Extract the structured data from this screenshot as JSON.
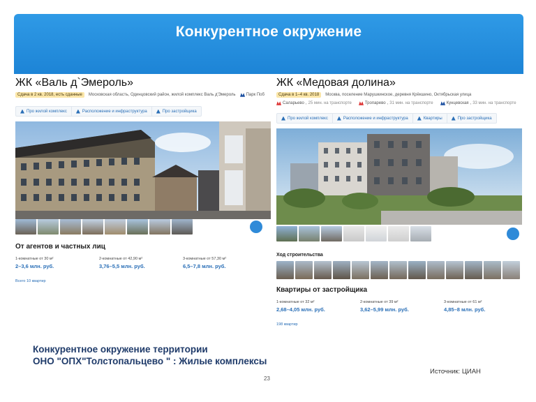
{
  "slide": {
    "title": "Конкурентное окружение",
    "footer_line1": "Конкурентное окружение территории",
    "footer_line2": "ОНО \"ОПХ\"Толстопальцево \" : Жилые комплексы",
    "page_number": "23",
    "source": "Источник: ЦИАН"
  },
  "left": {
    "title": "ЖК «Валь д`Эмероль»",
    "badge": "Сдача в 2 кв. 2018, есть сданные",
    "address": "Московская область, Одинцовский район, жилой комплекс Валь д'Эмероль",
    "metro": "Парк Поб",
    "tabs": [
      "Про жилой комплекс",
      "Расположение и инфраструктура",
      "Про застройщика"
    ],
    "badge360": "360°",
    "offers_heading": "От агентов и частных лиц",
    "prices": [
      {
        "label": "1-комнатные от 30 м²",
        "value": "2–3,6 млн. руб."
      },
      {
        "label": "2-комнатные от 42,90 м²",
        "value": "3,76–5,5 млн. руб."
      },
      {
        "label": "3-комнатные от 57,30 м²",
        "value": "6,5–7,8 млн. руб."
      }
    ],
    "total": "Всего 10 квартир"
  },
  "right": {
    "title": "ЖК «Медовая долина»",
    "badge": "Сдача в 1–4 кв. 2018",
    "address": "Москва, поселение Марушкинское, деревня Крёкшино, Октябрьская улица",
    "metro": [
      {
        "name": "Саларьево",
        "time": "25 мин. на транспорте"
      },
      {
        "name": "Тропарево",
        "time": "31 мин. на транспорте"
      },
      {
        "name": "Кунцевская",
        "time": "33 мин. на транспорте"
      }
    ],
    "tabs": [
      "Про жилой комплекс",
      "Расположение и инфраструктура",
      "Квартиры",
      "Про застройщика"
    ],
    "badge360": "360°",
    "construction_heading": "Ход строительства",
    "offers_heading": "Квартиры от застройщика",
    "prices": [
      {
        "label": "1-комнатные от 32 м²",
        "value": "2,68–4,05 млн. руб."
      },
      {
        "label": "2-комнатные от 39 м²",
        "value": "3,62–5,99 млн. руб."
      },
      {
        "label": "3-комнатные от 61 м²",
        "value": "4,85–8 млн. руб."
      }
    ],
    "total": "198 квартир"
  }
}
